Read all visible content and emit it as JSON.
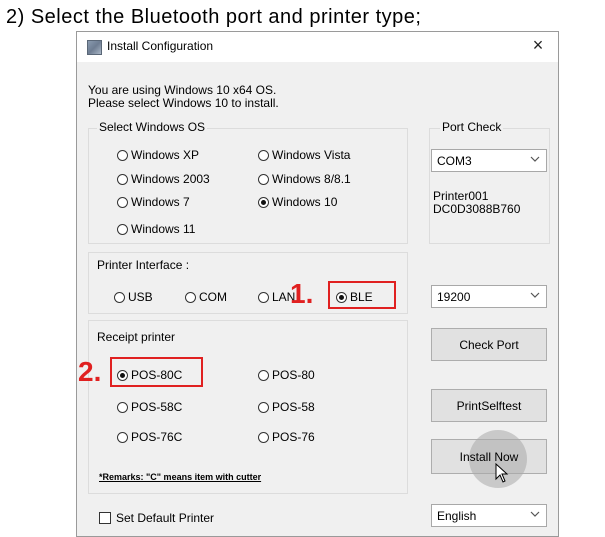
{
  "caption": "2) Select the Bluetooth port and printer type;",
  "window": {
    "title": "Install Configuration",
    "close_glyph": "×"
  },
  "intro": {
    "line1": "You are using Windows 10 x64 OS.",
    "line2": "Please select Windows 10 to install."
  },
  "os_group": {
    "label": "Select Windows OS",
    "options": [
      "Windows XP",
      "Windows Vista",
      "Windows 2003",
      "Windows 8/8.1",
      "Windows 7",
      "Windows 10",
      "Windows 11"
    ],
    "selected": "Windows 10"
  },
  "port_check": {
    "label": "Port Check",
    "port_value": "COM3",
    "info_line1": "Printer001",
    "info_line2": "DC0D3088B760"
  },
  "interface_group": {
    "label": "Printer Interface :",
    "options": [
      "USB",
      "COM",
      "LAN",
      "BLE"
    ],
    "selected": "BLE"
  },
  "baud_select": {
    "value": "19200"
  },
  "receipt_group": {
    "label": "Receipt printer",
    "options": [
      "POS-80C",
      "POS-80",
      "POS-58C",
      "POS-58",
      "POS-76C",
      "POS-76"
    ],
    "selected": "POS-80C",
    "remark": "*Remarks: \"C\" means item with cutter"
  },
  "buttons": {
    "check_port": "Check Port",
    "print_selftest": "PrintSelftest",
    "install_now": "Install Now"
  },
  "default_printer": {
    "label": "Set Default Printer",
    "checked": false
  },
  "language_select": {
    "value": "English"
  },
  "annotations": {
    "step1": "1.",
    "step2": "2."
  },
  "colors": {
    "accent_red": "#e02020",
    "window_bg": "#f0f0f0"
  },
  "icons": [
    "app-icon",
    "close-icon",
    "chevron-down-icon",
    "cursor-icon"
  ]
}
